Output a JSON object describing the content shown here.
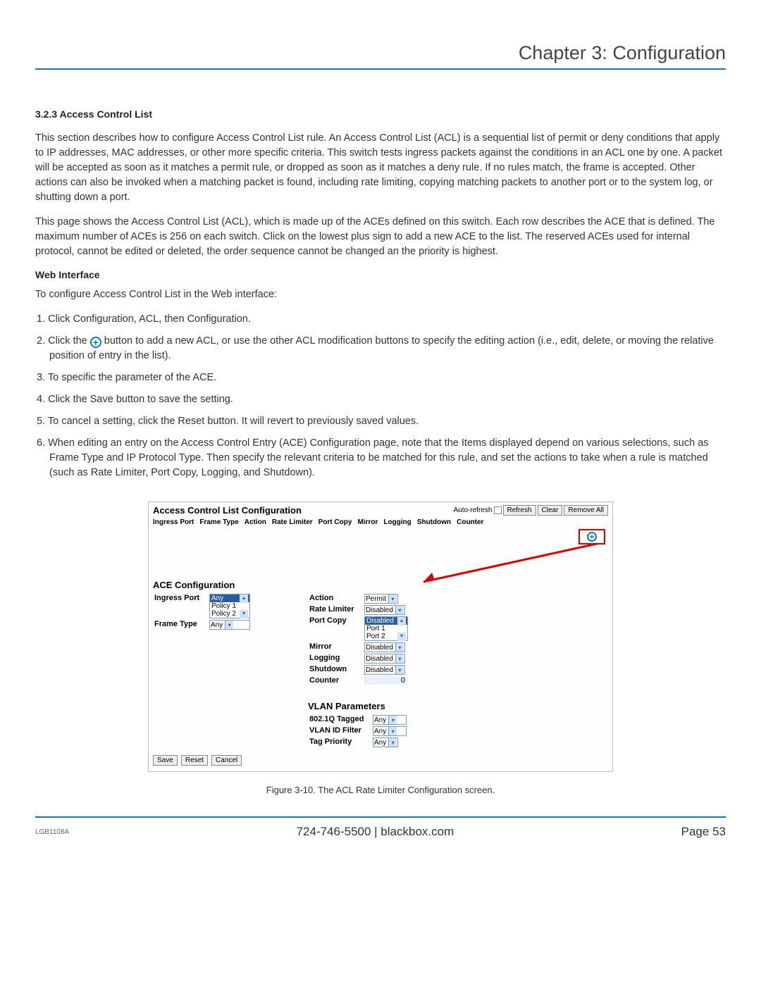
{
  "chapter_title": "Chapter 3: Configuration",
  "section_num_title": "3.2.3 Access Control List",
  "para1": "This section describes how to configure Access Control List rule. An Access Control List (ACL) is a sequential list of permit or deny conditions that apply to IP addresses, MAC addresses, or other more specific criteria. This switch tests ingress packets against the conditions in an ACL one by one. A packet will be accepted as soon as it matches a permit rule, or dropped as soon as it matches a deny rule. If no rules match, the frame is accepted. Other actions can also be invoked when a matching packet is found, including rate limiting, copying matching packets to another port or to the system log, or shutting down a port.",
  "para2": "This page shows the Access Control List (ACL), which is made up of the ACEs defined on this switch. Each row describes the ACE that is defined. The maximum number of ACEs is 256 on each switch. Click on the lowest plus sign to add a new ACE to the list. The reserved ACEs used for internal protocol, cannot be edited or deleted, the order sequence cannot be changed an the priority is highest.",
  "web_interface": "Web Interface",
  "intro_line": "To configure Access Control List in the Web interface:",
  "steps": {
    "s1": "1. Click Configuration, ACL, then Configuration.",
    "s2a": "2. Click the ",
    "s2b": " button to add a new ACL, or use the other ACL modification buttons to specify the editing action (i.e., edit, delete, or moving the relative position of entry in the list).",
    "s3": "3. To specific the parameter of the ACE.",
    "s4": "4. Click the Save button to save the setting.",
    "s5": "5. To cancel a setting, click the Reset button. It will revert to previously saved values.",
    "s6": "6. When editing an entry on the Access Control Entry (ACE) Configuration page, note that the Items displayed depend on various selections, such as Frame Type and IP Protocol Type. Then specify the relevant criteria to be matched for this rule, and set the actions to take when a rule is matched (such as Rate Limiter, Port Copy, Logging, and Shutdown)."
  },
  "ss": {
    "title": "Access Control List Configuration",
    "auto_refresh": "Auto-refresh",
    "btn_refresh": "Refresh",
    "btn_clear": "Clear",
    "btn_remove_all": "Remove All",
    "headers": {
      "h1": "Ingress Port",
      "h2": "Frame Type",
      "h3": "Action",
      "h4": "Rate Limiter",
      "h5": "Port Copy",
      "h6": "Mirror",
      "h7": "Logging",
      "h8": "Shutdown",
      "h9": "Counter"
    },
    "ace_title": "ACE Configuration",
    "left": {
      "ingress_label": "Ingress Port",
      "ingress_sel": "Any",
      "ingress_opt1": "Policy 1",
      "ingress_opt2": "Policy 2",
      "frame_label": "Frame Type",
      "frame_val": "Any"
    },
    "right": {
      "action_label": "Action",
      "action_val": "Permit",
      "rate_label": "Rate Limiter",
      "rate_val": "Disabled",
      "portcopy_label": "Port Copy",
      "portcopy_sel": "Disabled",
      "portcopy_opt1": "Port 1",
      "portcopy_opt2": "Port 2",
      "mirror_label": "Mirror",
      "mirror_val": "Disabled",
      "logging_label": "Logging",
      "logging_val": "Disabled",
      "shutdown_label": "Shutdown",
      "shutdown_val": "Disabled",
      "counter_label": "Counter",
      "counter_val": "0"
    },
    "vlan_title": "VLAN Parameters",
    "vlan": {
      "tagged_label": "802.1Q Tagged",
      "tagged_val": "Any",
      "vid_label": "VLAN ID Filter",
      "vid_val": "Any",
      "tag_label": "Tag Priority",
      "tag_val": "Any"
    },
    "btn_save": "Save",
    "btn_reset": "Reset",
    "btn_cancel": "Cancel"
  },
  "figure_caption": "Figure 3-10. The ACL Rate Limiter Configuration screen.",
  "footer": {
    "model": "LGB1108A",
    "center": "724-746-5500   |   blackbox.com",
    "page": "Page 53"
  }
}
